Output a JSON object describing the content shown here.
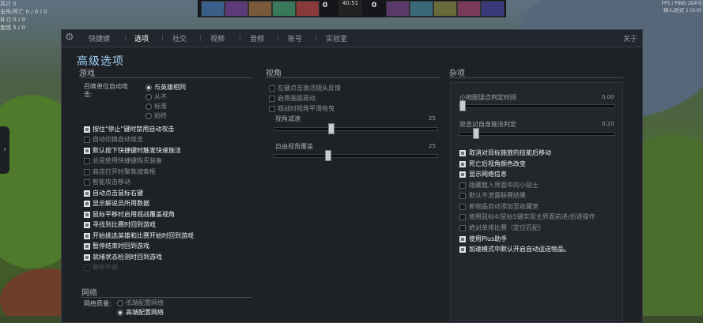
{
  "hud": {
    "top_left_lines": [
      "共计 0",
      "击杀/死亡 0 / 0 / 0",
      "补刀 0 / 0",
      "金钱 5 / 0"
    ],
    "top_right_lines": [
      "FPS / PING 204 0",
      "输入/延迟 1 (0.0)"
    ],
    "score_left": "0",
    "score_right": "0",
    "clock": "40:51",
    "side_arrow": "›"
  },
  "tabs": {
    "items": [
      "快捷键",
      "选项",
      "社交",
      "视频",
      "音频",
      "账号",
      "实验室"
    ],
    "active_index": 1,
    "about": "关于",
    "settings_icon": "gear-icon"
  },
  "title": "高级选项",
  "game": {
    "header": "游戏",
    "summon_label": "召唤单位自动攻击:",
    "summon_options": [
      {
        "label": "与英雄相同",
        "selected": true
      },
      {
        "label": "从不",
        "selected": false
      },
      {
        "label": "标准",
        "selected": false
      },
      {
        "label": "始终",
        "selected": false
      }
    ],
    "checkboxes": [
      {
        "label": "按住\"停止\"键时禁用自动攻击",
        "checked": true,
        "state": "on"
      },
      {
        "label": "自动切换自动攻击",
        "checked": false,
        "state": "off"
      },
      {
        "label": "默认按下快捷键时触发快速施法",
        "checked": true,
        "state": "on"
      },
      {
        "label": "总是使用快捷键购买装备",
        "checked": false,
        "state": "off"
      },
      {
        "label": "商店打开时聚焦搜索框",
        "checked": false,
        "state": "off"
      },
      {
        "label": "智能攻击移动",
        "checked": false,
        "state": "off"
      },
      {
        "label": "自动点击鼠标右键",
        "checked": true,
        "state": "on"
      },
      {
        "label": "显示解说员所用数据",
        "checked": true,
        "state": "on"
      },
      {
        "label": "鼠标平移时启用观战覆盖视角",
        "checked": true,
        "state": "on"
      },
      {
        "label": "寻找到比赛时回到游戏",
        "checked": true,
        "state": "on"
      },
      {
        "label": "开始挑选英雄和比赛开始时回到游戏",
        "checked": true,
        "state": "on"
      },
      {
        "label": "暂停结束时回到游戏",
        "checked": true,
        "state": "on"
      },
      {
        "label": "就绪状态检测时回到游戏",
        "checked": true,
        "state": "on"
      },
      {
        "label": "聊天中继",
        "checked": false,
        "state": "dim"
      }
    ]
  },
  "network": {
    "header": "网络",
    "quality_label": "网络质量:",
    "options": [
      {
        "label": "低端配置网络",
        "selected": false
      },
      {
        "label": "高端配置网络",
        "selected": true
      }
    ]
  },
  "camera": {
    "header": "视角",
    "checkboxes": [
      {
        "label": "左键点击激活镜头反馈",
        "checked": false
      },
      {
        "label": "启用画面晃动",
        "checked": false
      },
      {
        "label": "观战时视角平滑拖曳",
        "checked": false
      }
    ],
    "sliders": [
      {
        "label": "视角减速",
        "value": "25",
        "fraction": 0.34
      },
      {
        "label": "自由视角覆盖",
        "value": "25",
        "fraction": 0.32
      }
    ]
  },
  "misc": {
    "header": "杂项",
    "sliders": [
      {
        "label": "小地图误点判定时间",
        "value": "0.00",
        "fraction": 0.0
      },
      {
        "label": "双击对自身施法判定",
        "value": "0.20",
        "fraction": 0.1
      }
    ],
    "checkboxes": [
      {
        "label": "取消对目标施放的技能后移动",
        "checked": true,
        "state": "on"
      },
      {
        "label": "死亡后视角颜色改变",
        "checked": true,
        "state": "on"
      },
      {
        "label": "显示网络信息",
        "checked": true,
        "state": "on"
      },
      {
        "label": "隐藏载入界面中的小贴士",
        "checked": false,
        "state": "off"
      },
      {
        "label": "默认不泄露联赛结果",
        "checked": false,
        "state": "off"
      },
      {
        "label": "新物品自动添加至收藏室",
        "checked": false,
        "state": "off"
      },
      {
        "label": "使用鼠标4/鼠标5键实现主界面前进/后退操作",
        "checked": false,
        "state": "off"
      },
      {
        "label": "绝对单排比赛（定位匹配）",
        "checked": false,
        "state": "off"
      },
      {
        "label": "使用Plus助手",
        "checked": true,
        "state": "on"
      },
      {
        "label": "加速模式中默认开启自动运送物品。",
        "checked": true,
        "state": "on"
      }
    ]
  },
  "colors": {
    "title": "#9fd0f5",
    "panel": "#1e2126",
    "accent_check": "#dfe3ea"
  }
}
